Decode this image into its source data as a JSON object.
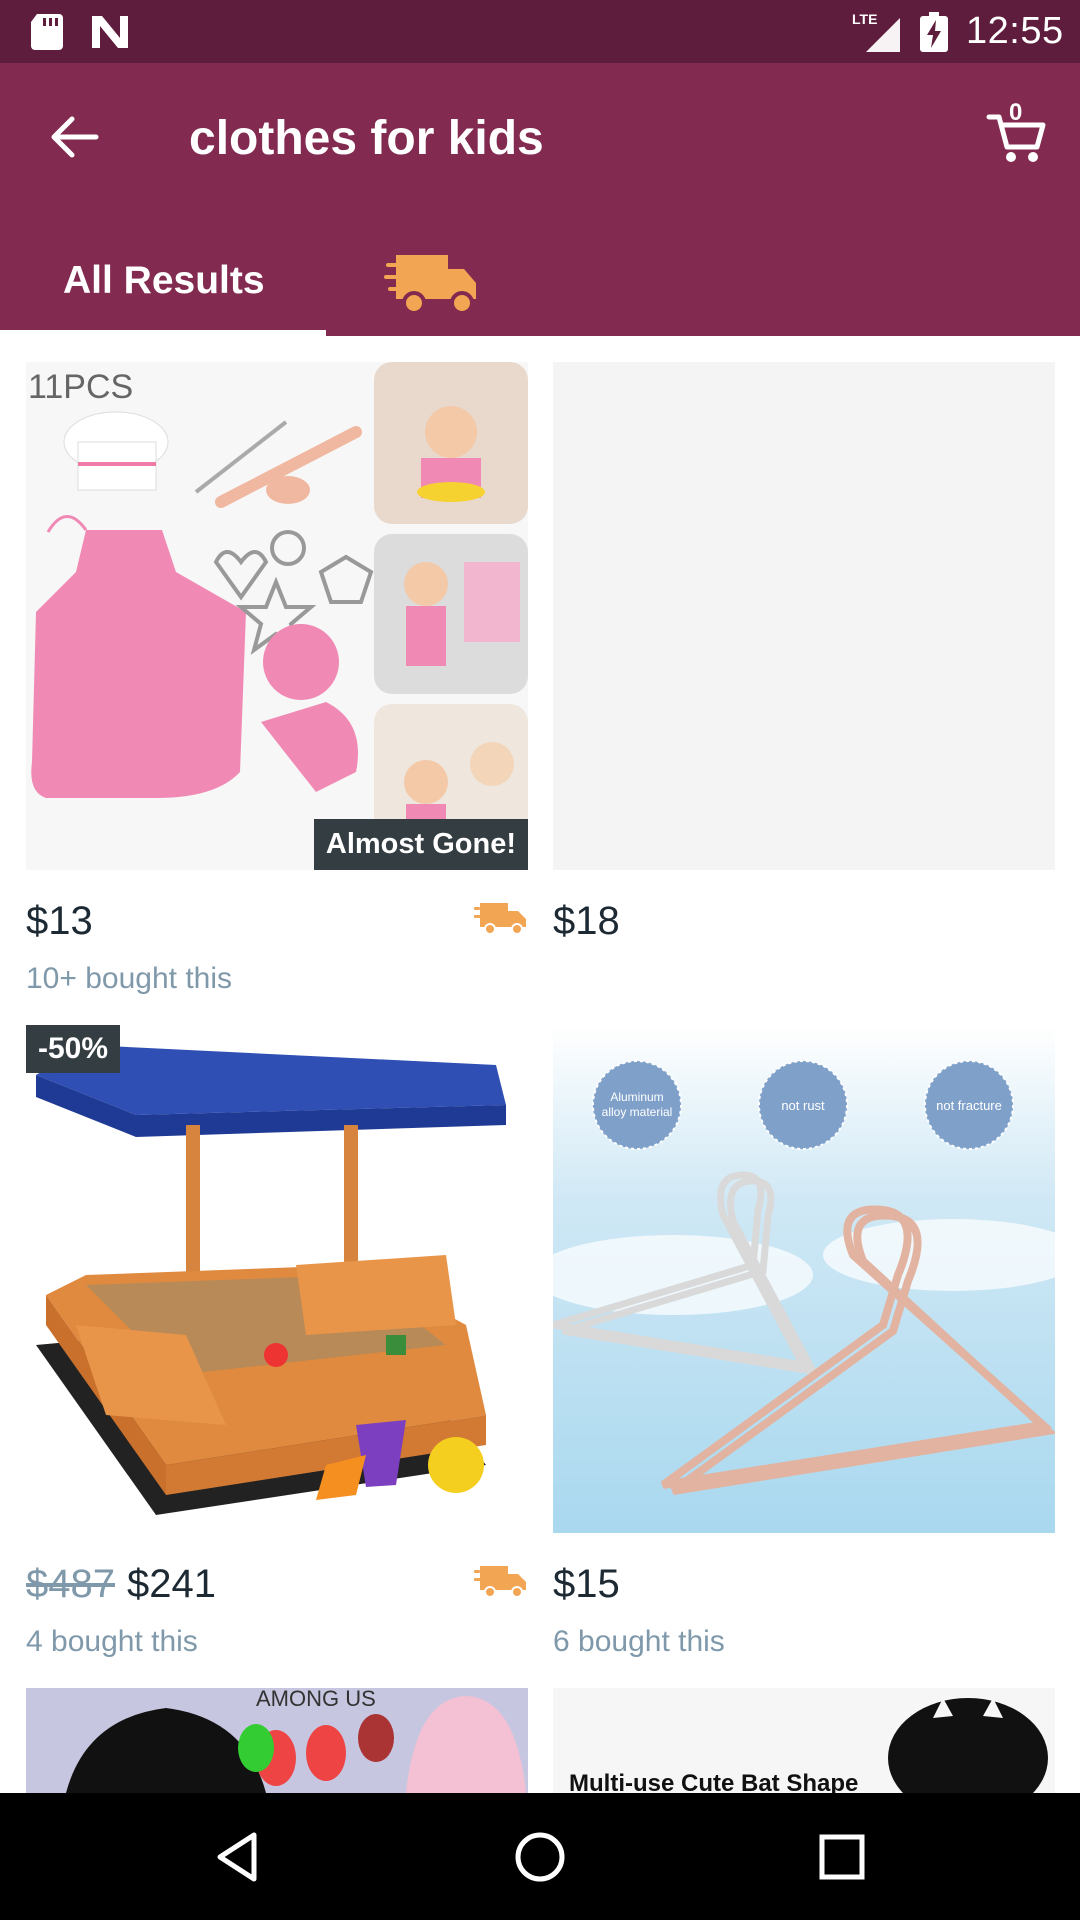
{
  "status_bar": {
    "time": "12:55",
    "network": "LTE",
    "icons": [
      "sd-card-icon",
      "n-notification-icon",
      "signal-icon",
      "battery-charging-icon"
    ]
  },
  "app_bar": {
    "search_query": "clothes for kids",
    "cart_count": "0",
    "tabs": [
      {
        "label": "All Results",
        "selected": true
      },
      {
        "icon": "fast-shipping-truck-icon",
        "selected": false
      }
    ]
  },
  "products": [
    {
      "image_text": "11PCS",
      "badge": "Almost Gone!",
      "price": "$13",
      "bought": "10+ bought this",
      "fast_shipping": true
    },
    {
      "price": "$18",
      "fast_shipping": false
    },
    {
      "badge": "-50%",
      "original_price": "$487",
      "price": "$241",
      "bought": "4 bought this",
      "fast_shipping": true
    },
    {
      "image_labels": [
        "Aluminum alloy material",
        "not rust",
        "not fracture"
      ],
      "price": "$15",
      "bought": "6 bought this",
      "fast_shipping": false
    },
    {
      "image_text": "AMONG US"
    },
    {
      "image_text": "Multi-use Cute Bat Shape"
    }
  ],
  "colors": {
    "status_bar": "#5e1d3c",
    "app_bar": "#832a50",
    "shipping_accent": "#f2a553",
    "badge": "#333d42",
    "muted_text": "#7f99ab"
  },
  "nav_bar": {
    "icons": [
      "back-triangle-icon",
      "home-circle-icon",
      "recents-square-icon"
    ]
  }
}
